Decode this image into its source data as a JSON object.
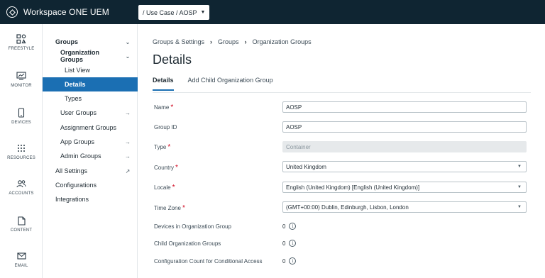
{
  "app": {
    "title": "Workspace ONE UEM"
  },
  "scope": {
    "label": "/ Use Case / AOSP"
  },
  "rail": {
    "items": [
      {
        "label": "FREESTYLE",
        "icon": "freestyle-icon"
      },
      {
        "label": "MONITOR",
        "icon": "monitor-icon"
      },
      {
        "label": "DEVICES",
        "icon": "devices-icon"
      },
      {
        "label": "RESOURCES",
        "icon": "resources-icon"
      },
      {
        "label": "ACCOUNTS",
        "icon": "accounts-icon"
      },
      {
        "label": "CONTENT",
        "icon": "content-icon"
      },
      {
        "label": "EMAIL",
        "icon": "email-icon"
      }
    ]
  },
  "subnav": {
    "items": [
      {
        "label": "Groups",
        "chevron": "⌄"
      },
      {
        "label": "Organization Groups",
        "chevron": "⌄"
      },
      {
        "label": "List View"
      },
      {
        "label": "Details"
      },
      {
        "label": "Types"
      },
      {
        "label": "User Groups",
        "chevron": "→"
      },
      {
        "label": "Assignment Groups"
      },
      {
        "label": "App Groups",
        "chevron": "→"
      },
      {
        "label": "Admin Groups",
        "chevron": "→"
      },
      {
        "label": "All Settings",
        "chevron": "↗"
      },
      {
        "label": "Configurations"
      },
      {
        "label": "Integrations"
      }
    ]
  },
  "breadcrumb": [
    "Groups & Settings",
    "Groups",
    "Organization Groups"
  ],
  "page": {
    "title": "Details"
  },
  "tabs": [
    {
      "label": "Details"
    },
    {
      "label": "Add Child Organization Group"
    }
  ],
  "form": {
    "name": {
      "label": "Name",
      "value": "AOSP"
    },
    "group_id": {
      "label": "Group ID",
      "value": "AOSP"
    },
    "type": {
      "label": "Type",
      "value": "Container"
    },
    "country": {
      "label": "Country",
      "value": "United Kingdom"
    },
    "locale": {
      "label": "Locale",
      "value": "English (United Kingdom) [English (United Kingdom)]"
    },
    "time_zone": {
      "label": "Time Zone",
      "value": "(GMT+00:00) Dublin, Edinburgh, Lisbon, London"
    },
    "devices": {
      "label": "Devices in Organization Group",
      "value": "0"
    },
    "child_groups": {
      "label": "Child Organization Groups",
      "value": "0"
    },
    "config_count": {
      "label": "Configuration Count for Conditional Access",
      "value": "0"
    }
  },
  "colors": {
    "topbar": "#0f2532",
    "accent": "#1b6fb3",
    "required": "#d0021b"
  }
}
